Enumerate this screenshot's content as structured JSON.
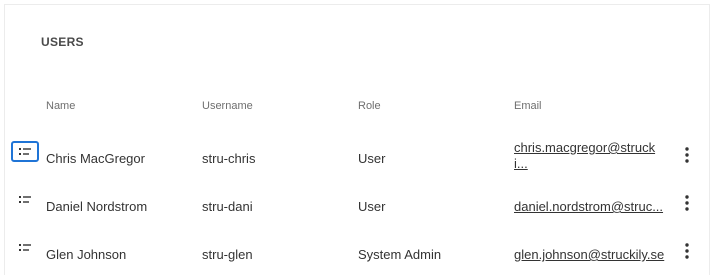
{
  "panel": {
    "title": "USERS"
  },
  "table": {
    "headers": {
      "name": "Name",
      "username": "Username",
      "role": "Role",
      "email": "Email"
    },
    "rows": [
      {
        "name": "Chris MacGregor",
        "username": "stru-chris",
        "role": "User",
        "email_line1": "chris.macgregor@struck",
        "email_line2": "i..."
      },
      {
        "name": "Daniel Nordstrom",
        "username": "stru-dani",
        "role": "User",
        "email": "daniel.nordstrom@struc..."
      },
      {
        "name": "Glen Johnson",
        "username": "stru-glen",
        "role": "System Admin",
        "email": "glen.johnson@struckily.se"
      }
    ]
  },
  "icons": {
    "row_details": "list-details-icon",
    "row_menu": "more-vertical-icon"
  },
  "colors": {
    "focus_ring": "#1f74d6",
    "text": "#333333",
    "header_text": "#6f6f6f"
  }
}
